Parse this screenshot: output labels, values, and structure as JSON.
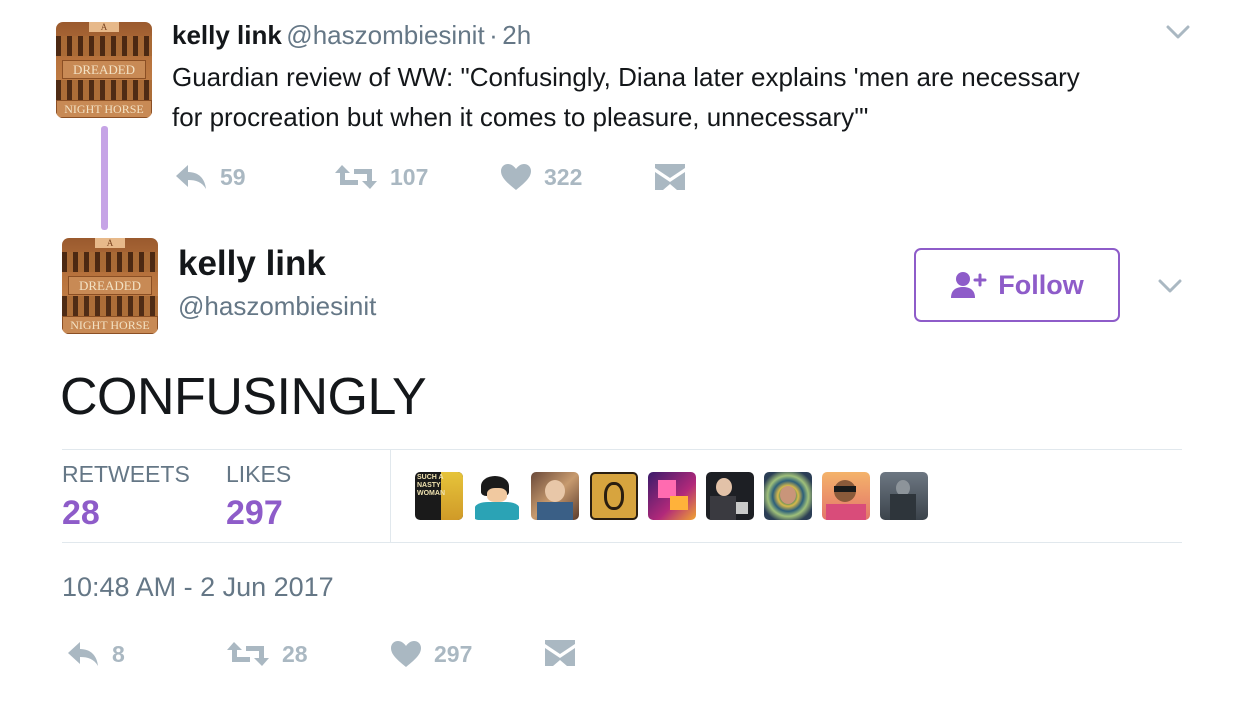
{
  "colors": {
    "accent": "#8e5cc9",
    "muted": "#aab8c2",
    "secondary_text": "#657786"
  },
  "avatar": {
    "top_label": "A",
    "line1": "DREADED",
    "line2": "NIGHT HORSE"
  },
  "parent_tweet": {
    "name": "kelly link",
    "handle": "@haszombiesinit",
    "separator": "·",
    "time": "2h",
    "text_line1": "Guardian review of WW: \"Confusingly, Diana later explains 'men are necessary",
    "text_line2": "for procreation but when it comes to pleasure, unnecessary'\"",
    "actions": {
      "replies": "59",
      "retweets": "107",
      "likes": "322"
    }
  },
  "main_tweet": {
    "name": "kelly link",
    "handle": "@haszombiesinit",
    "follow_label": "Follow",
    "text": "CONFUSINGLY",
    "stats": {
      "retweets_label": "RETWEETS",
      "retweets": "28",
      "likes_label": "LIKES",
      "likes": "297"
    },
    "likers": [
      {
        "icon": "nasty-woman-avatar",
        "text": "SUCH A NASTY WOMAN"
      },
      {
        "icon": "cartoon-avatar"
      },
      {
        "icon": "photo-avatar"
      },
      {
        "icon": "beard-icon-avatar"
      },
      {
        "icon": "pixel-art-avatar"
      },
      {
        "icon": "suit-photo-avatar"
      },
      {
        "icon": "spiral-photo-avatar"
      },
      {
        "icon": "sunglasses-photo-avatar"
      },
      {
        "icon": "statue-photo-avatar"
      }
    ],
    "timestamp": "10:48 AM - 2 Jun 2017",
    "actions": {
      "replies": "8",
      "retweets": "28",
      "likes": "297"
    }
  }
}
